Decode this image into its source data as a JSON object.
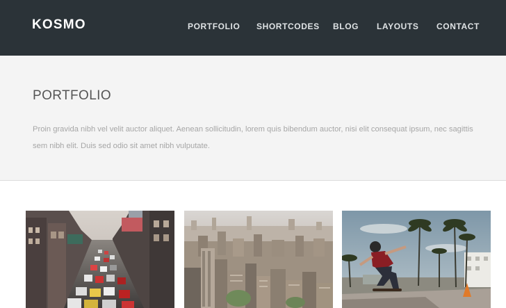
{
  "header": {
    "logo": "KOSMO",
    "nav": [
      {
        "label": "PORTFOLIO"
      },
      {
        "label": "SHORTCODES"
      },
      {
        "label": "BLOG"
      },
      {
        "label": "LAYOUTS"
      },
      {
        "label": "CONTACT"
      }
    ]
  },
  "hero": {
    "title": "PORTFOLIO",
    "intro": "Proin gravida nibh vel velit auctor aliquet. Aenean sollicitudin, lorem quis bibendum auctor, nisi elit consequat ipsum, nec sagittis sem nibh elit. Duis sed odio sit amet nibh vulputate."
  },
  "portfolio": {
    "items": [
      {
        "image": "city-traffic-street-photo"
      },
      {
        "image": "city-skyline-aerial-photo"
      },
      {
        "image": "skateboarder-palm-trees-photo"
      }
    ]
  },
  "colors": {
    "header_bg": "#2b3338",
    "hero_bg": "#f4f4f4",
    "title_text": "#555555",
    "body_text": "#a6a6a6"
  }
}
